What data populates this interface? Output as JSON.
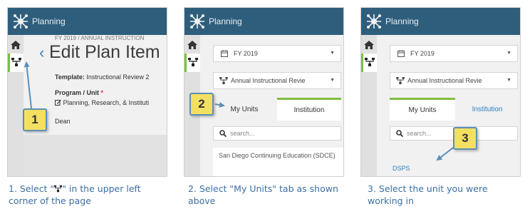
{
  "app": {
    "title": "Planning"
  },
  "panel1": {
    "breadcrumb": "FY 2019 / ANNUAL INSTRUCTION",
    "back_glyph": "‹",
    "page_title": "Edit Plan Item",
    "template_label": "Template:",
    "template_value": "Instructional Review 2",
    "program_label": "Program / Unit",
    "required_mark": "*",
    "program_value": "Planning, Research, & Instituti",
    "dean_label": "Dean",
    "callout": "1"
  },
  "panel2": {
    "fy_select": "FY 2019",
    "review_select": "Annual Instructional Revie",
    "tab_my_units": "My Units",
    "tab_institution": "Institution",
    "search_placeholder": "search...",
    "list_item": "San Diego Continuing Education (SDCE)",
    "callout": "2"
  },
  "panel3": {
    "fy_select": "FY 2019",
    "review_select": "Annual Instructional Revie",
    "tab_my_units": "My Units",
    "tab_institution": "Institution",
    "search_placeholder": "search...",
    "list_item": "DSPS",
    "callout": "3"
  },
  "captions": {
    "c1_before": "1. Select \"",
    "c1_after": "\" in the upper left corner of the page",
    "c2": "2. Select \"My Units\" tab as shown above",
    "c3": "3. Select the unit you were working in"
  },
  "icons": {
    "logo": "planning-logo-icon",
    "home": "home-icon",
    "hierarchy": "hierarchy-icon",
    "calendar": "calendar-icon",
    "search": "search-icon",
    "caret": "caret-down-icon"
  },
  "colors": {
    "topbar": "#2e5e7c",
    "accent_green": "#7dbf3f",
    "link_blue": "#2a7fbf",
    "callout_fill": "#f4e060",
    "callout_border": "#5b8fb9",
    "caption_blue": "#3c6fa5"
  }
}
